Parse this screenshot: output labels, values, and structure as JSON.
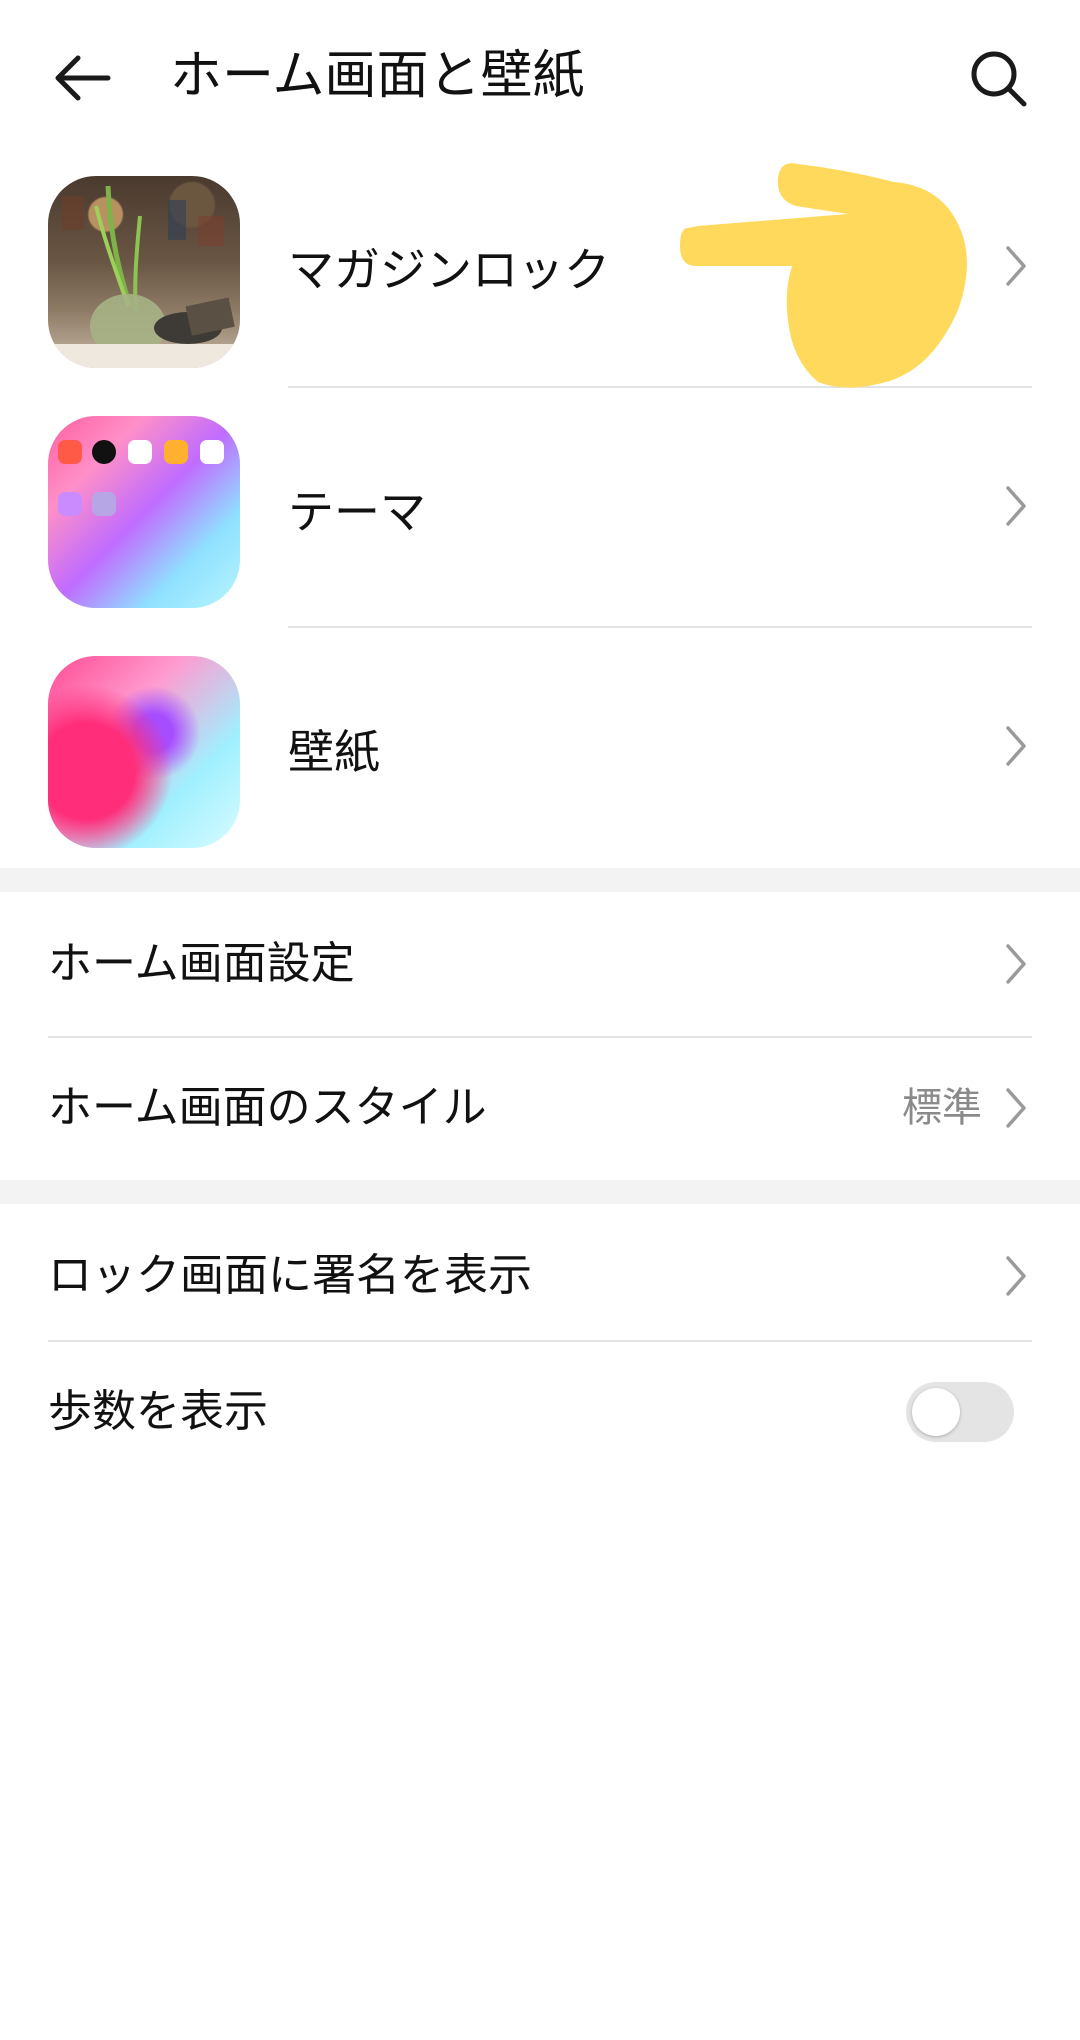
{
  "header": {
    "title": "ホーム画面と壁紙",
    "back_icon": "arrow-left-icon",
    "search_icon": "search-icon"
  },
  "image_items": [
    {
      "label": "マガジンロック",
      "thumb": "magazine-lock-thumbnail"
    },
    {
      "label": "テーマ",
      "thumb": "theme-thumbnail"
    },
    {
      "label": "壁紙",
      "thumb": "wallpaper-thumbnail"
    }
  ],
  "home_section": {
    "items": [
      {
        "label": "ホーム画面設定"
      },
      {
        "label": "ホーム画面のスタイル",
        "value": "標準"
      }
    ]
  },
  "lock_section": {
    "items": [
      {
        "label": "ロック画面に署名を表示"
      },
      {
        "label": "歩数を表示",
        "toggle_on": false
      }
    ]
  },
  "colors": {
    "pointer_hand": "#FFD95C",
    "divider": "#E3E3E3",
    "section_gap": "#F3F3F3",
    "secondary_text": "#8A8A8A",
    "toggle_off": "#E4E4E4"
  }
}
